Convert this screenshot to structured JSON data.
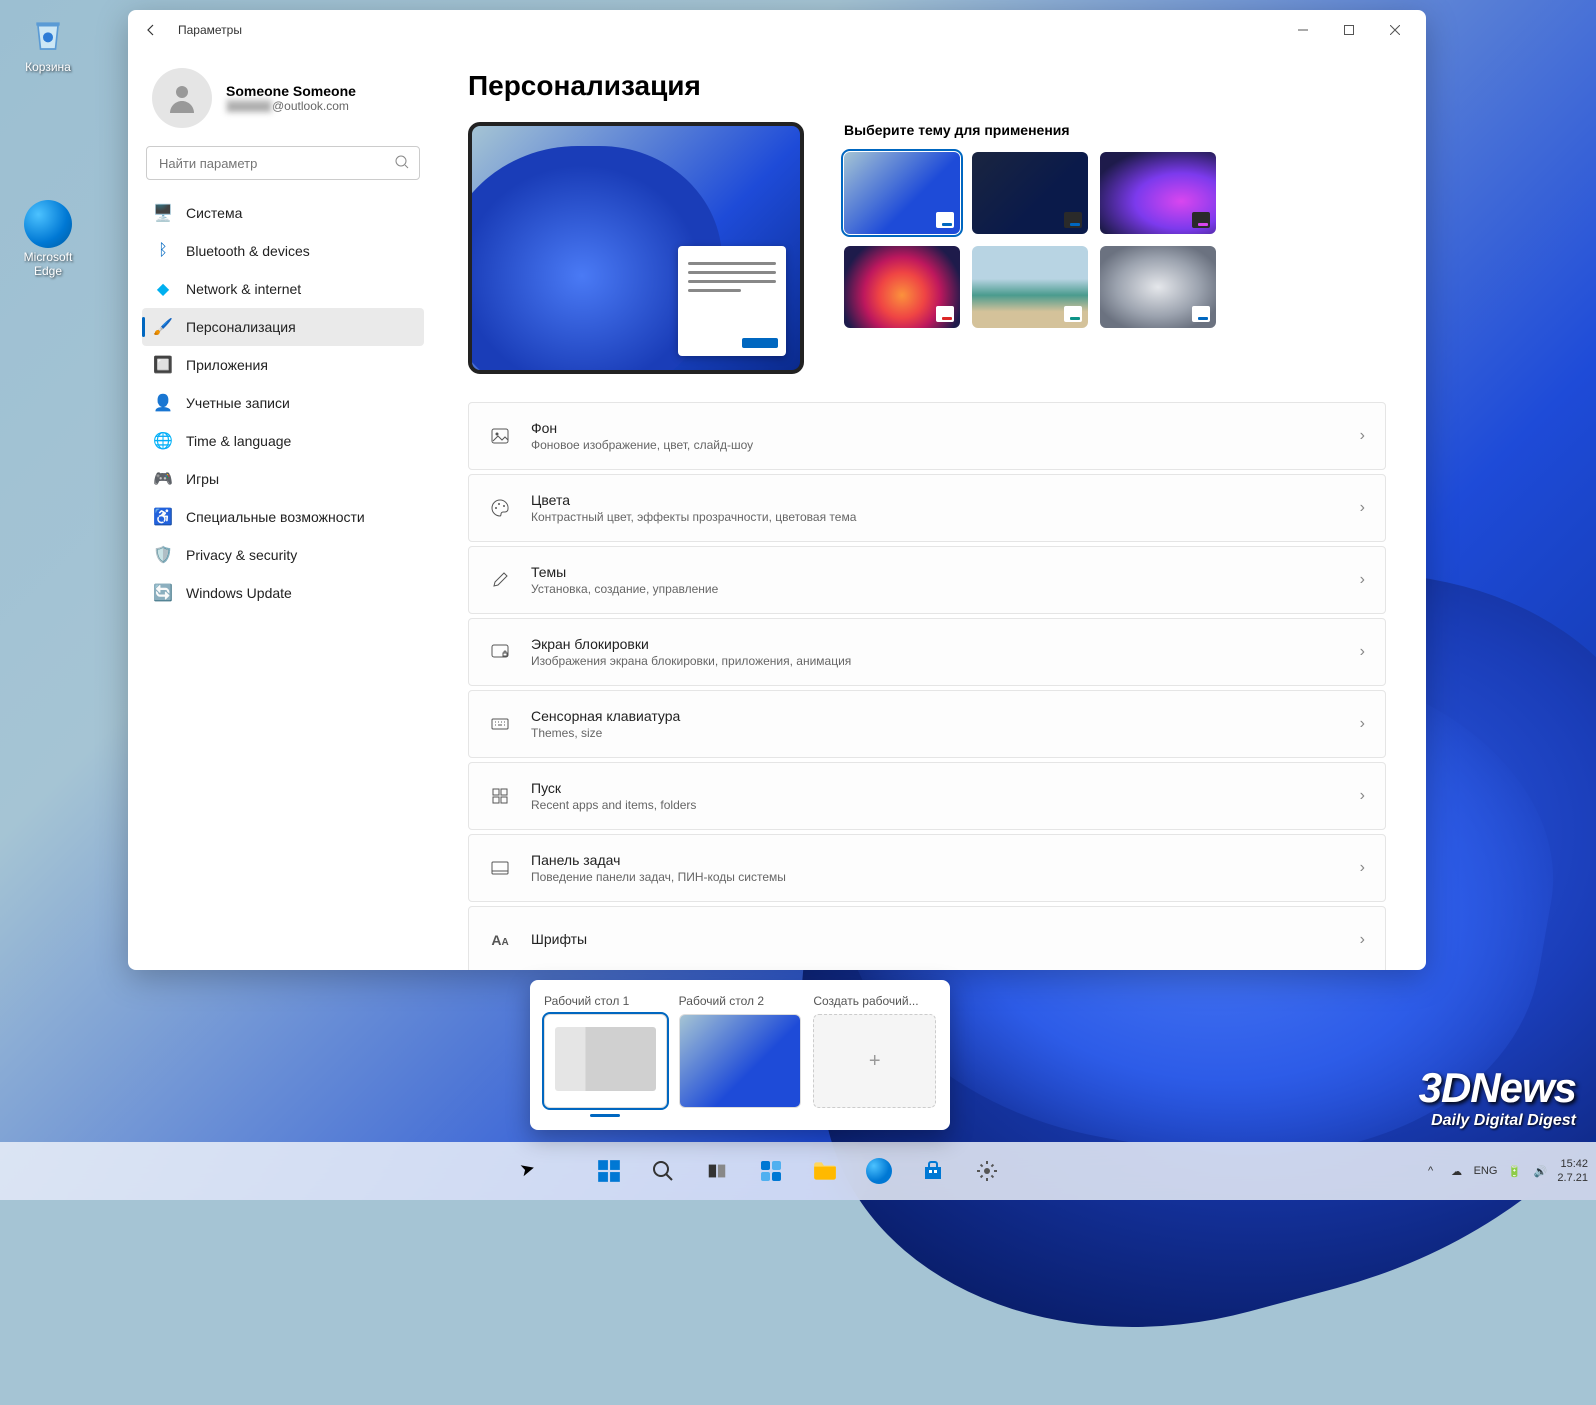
{
  "desktop": {
    "recycle_bin": "Корзина",
    "edge": "Microsoft Edge"
  },
  "window": {
    "title": "Параметры"
  },
  "account": {
    "name": "Someone Someone",
    "email_suffix": "@outlook.com"
  },
  "search": {
    "placeholder": "Найти параметр"
  },
  "nav": {
    "system": "Система",
    "bluetooth": "Bluetooth & devices",
    "network": "Network & internet",
    "personalization": "Персонализация",
    "apps": "Приложения",
    "accounts": "Учетные записи",
    "time": "Time & language",
    "gaming": "Игры",
    "accessibility": "Специальные возможности",
    "privacy": "Privacy & security",
    "update": "Windows Update"
  },
  "page": {
    "title": "Персонализация",
    "theme_header": "Выберите тему для применения"
  },
  "settings": {
    "bg": {
      "title": "Фон",
      "desc": "Фоновое изображение, цвет, слайд-шоу"
    },
    "colors": {
      "title": "Цвета",
      "desc": "Контрастный цвет, эффекты прозрачности, цветовая тема"
    },
    "themes": {
      "title": "Темы",
      "desc": "Установка, создание, управление"
    },
    "lock": {
      "title": "Экран блокировки",
      "desc": "Изображения экрана блокировки, приложения, анимация"
    },
    "keyboard": {
      "title": "Сенсорная клавиатура",
      "desc": "Themes, size"
    },
    "start": {
      "title": "Пуск",
      "desc": "Recent apps and items, folders"
    },
    "taskbar": {
      "title": "Панель задач",
      "desc": "Поведение панели задач, ПИН-коды системы"
    },
    "fonts": {
      "title": "Шрифты",
      "desc": ""
    }
  },
  "taskview": {
    "desk1": "Рабочий стол 1",
    "desk2": "Рабочий стол 2",
    "new": "Создать рабочий..."
  },
  "tray": {
    "lang": "ENG",
    "time": "15:42",
    "date": "2.7.21"
  },
  "watermark": {
    "line1": "3DNews",
    "line2": "Daily Digital Digest"
  }
}
